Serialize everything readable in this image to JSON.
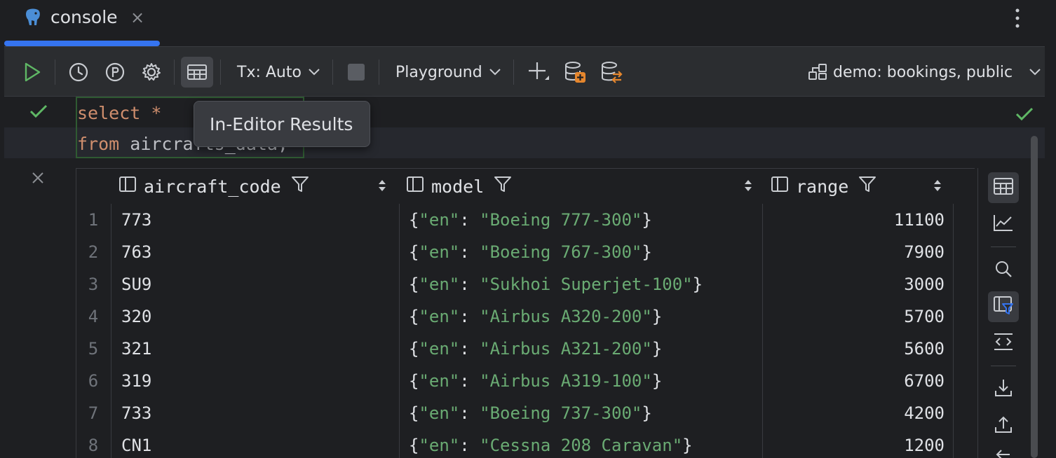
{
  "tab": {
    "title": "console",
    "close": "×"
  },
  "toolbar": {
    "tx_label": "Tx: Auto",
    "session_label": "Playground",
    "datasource_label": "demo: bookings, public"
  },
  "editor": {
    "line1_kw": "select",
    "line1_rest": " *",
    "line2_kw": "from",
    "line2_rest": " aircrafts_data;",
    "tooltip": "In-Editor Results"
  },
  "results": {
    "columns": [
      "aircraft_code",
      "model",
      "range"
    ],
    "rows": [
      {
        "n": "1",
        "code": "773",
        "model": "Boeing 777-300",
        "range": "11100"
      },
      {
        "n": "2",
        "code": "763",
        "model": "Boeing 767-300",
        "range": "7900"
      },
      {
        "n": "3",
        "code": "SU9",
        "model": "Sukhoi Superjet-100",
        "range": "3000"
      },
      {
        "n": "4",
        "code": "320",
        "model": "Airbus A320-200",
        "range": "5700"
      },
      {
        "n": "5",
        "code": "321",
        "model": "Airbus A321-200",
        "range": "5600"
      },
      {
        "n": "6",
        "code": "319",
        "model": "Airbus A319-100",
        "range": "6700"
      },
      {
        "n": "7",
        "code": "733",
        "model": "Boeing 737-300",
        "range": "4200"
      },
      {
        "n": "8",
        "code": "CN1",
        "model": "Cessna 208 Caravan",
        "range": "1200"
      }
    ],
    "json_key": "\"en\""
  },
  "colors": {
    "accent": "#3574f0",
    "success": "#5fb865",
    "keyword": "#cf8e6d",
    "string": "#6aab73"
  },
  "icons": {
    "tab": "postgresql-elephant-icon",
    "toolbar": [
      "run-icon",
      "history-icon",
      "parameters-icon",
      "settings-icon",
      "in-editor-results-icon",
      "stop-icon",
      "add-icon",
      "database-add-icon",
      "database-switch-icon",
      "datasource-icon"
    ],
    "strip": [
      "table-view-icon",
      "chart-icon",
      "search-icon",
      "filter-icon",
      "code-view-icon",
      "export-icon",
      "import-icon"
    ]
  }
}
